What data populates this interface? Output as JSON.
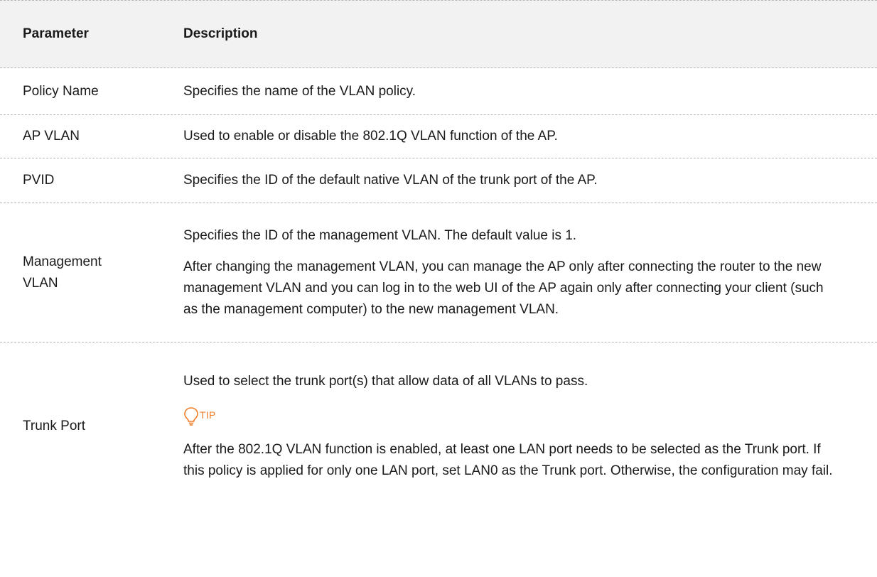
{
  "table": {
    "headers": {
      "parameter": "Parameter",
      "description": "Description"
    },
    "rows": [
      {
        "parameter": "Policy Name",
        "description": [
          "Specifies the name of the VLAN policy."
        ]
      },
      {
        "parameter": "AP VLAN",
        "description": [
          "Used to enable or disable the 802.1Q VLAN function of the AP."
        ]
      },
      {
        "parameter": "PVID",
        "description": [
          "Specifies the ID of the default native VLAN of the trunk port of the AP."
        ]
      },
      {
        "parameter": "Management VLAN",
        "description": [
          "Specifies the ID of the management VLAN. The default value is 1.",
          "After changing the management VLAN, you can manage the AP only after connecting the router to the new management VLAN and you can log in to the web UI of the AP again only after connecting your client (such as the management computer) to the new management VLAN."
        ]
      },
      {
        "parameter": "Trunk Port",
        "description": [
          "Used to select the trunk port(s) that allow data of all VLANs to pass.",
          "After the 802.1Q VLAN function is enabled, at least one LAN port needs to be selected as the Trunk port. If this policy is applied for only one LAN port, set LAN0 as the Trunk port. Otherwise, the configuration may fail."
        ],
        "tip": {
          "label": "TIP",
          "icon": "lightbulb-icon",
          "color": "#f07b25"
        }
      }
    ]
  }
}
